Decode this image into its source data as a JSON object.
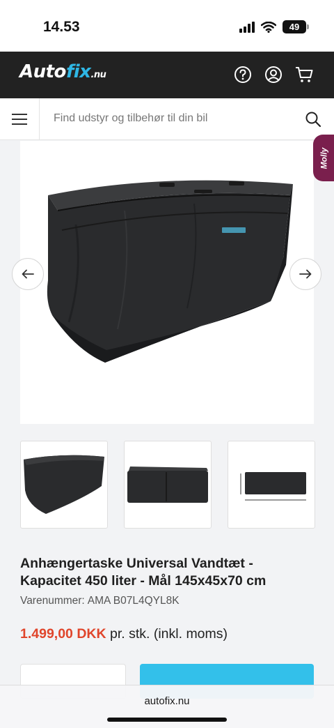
{
  "status": {
    "time": "14.53",
    "battery": "49"
  },
  "header": {
    "logo_main": "Auto",
    "logo_accent": "fix",
    "logo_tld": ".nu",
    "icons": [
      "help-icon",
      "account-icon",
      "cart-icon"
    ]
  },
  "search": {
    "placeholder": "Find udstyr og tilbehør til din bil"
  },
  "chat_tab": {
    "label": "Molly"
  },
  "gallery": {
    "thumbnail_count": 3
  },
  "product": {
    "title": "Anhængertaske Universal Vandtæt - Kapacitet 450 liter - Mål 145x45x70 cm",
    "sku_label": "Varenummer:",
    "sku_value": "AMA B07L4QYL8K",
    "price": "1.499,00 DKK",
    "price_suffix": "pr. stk. (inkl. moms)"
  },
  "browser": {
    "url": "autofix.nu"
  },
  "colors": {
    "header_bg": "#222222",
    "accent": "#2fb7e5",
    "price": "#e0452b",
    "cart_button": "#33c0ea",
    "chat_tab": "#7a1f4d"
  }
}
